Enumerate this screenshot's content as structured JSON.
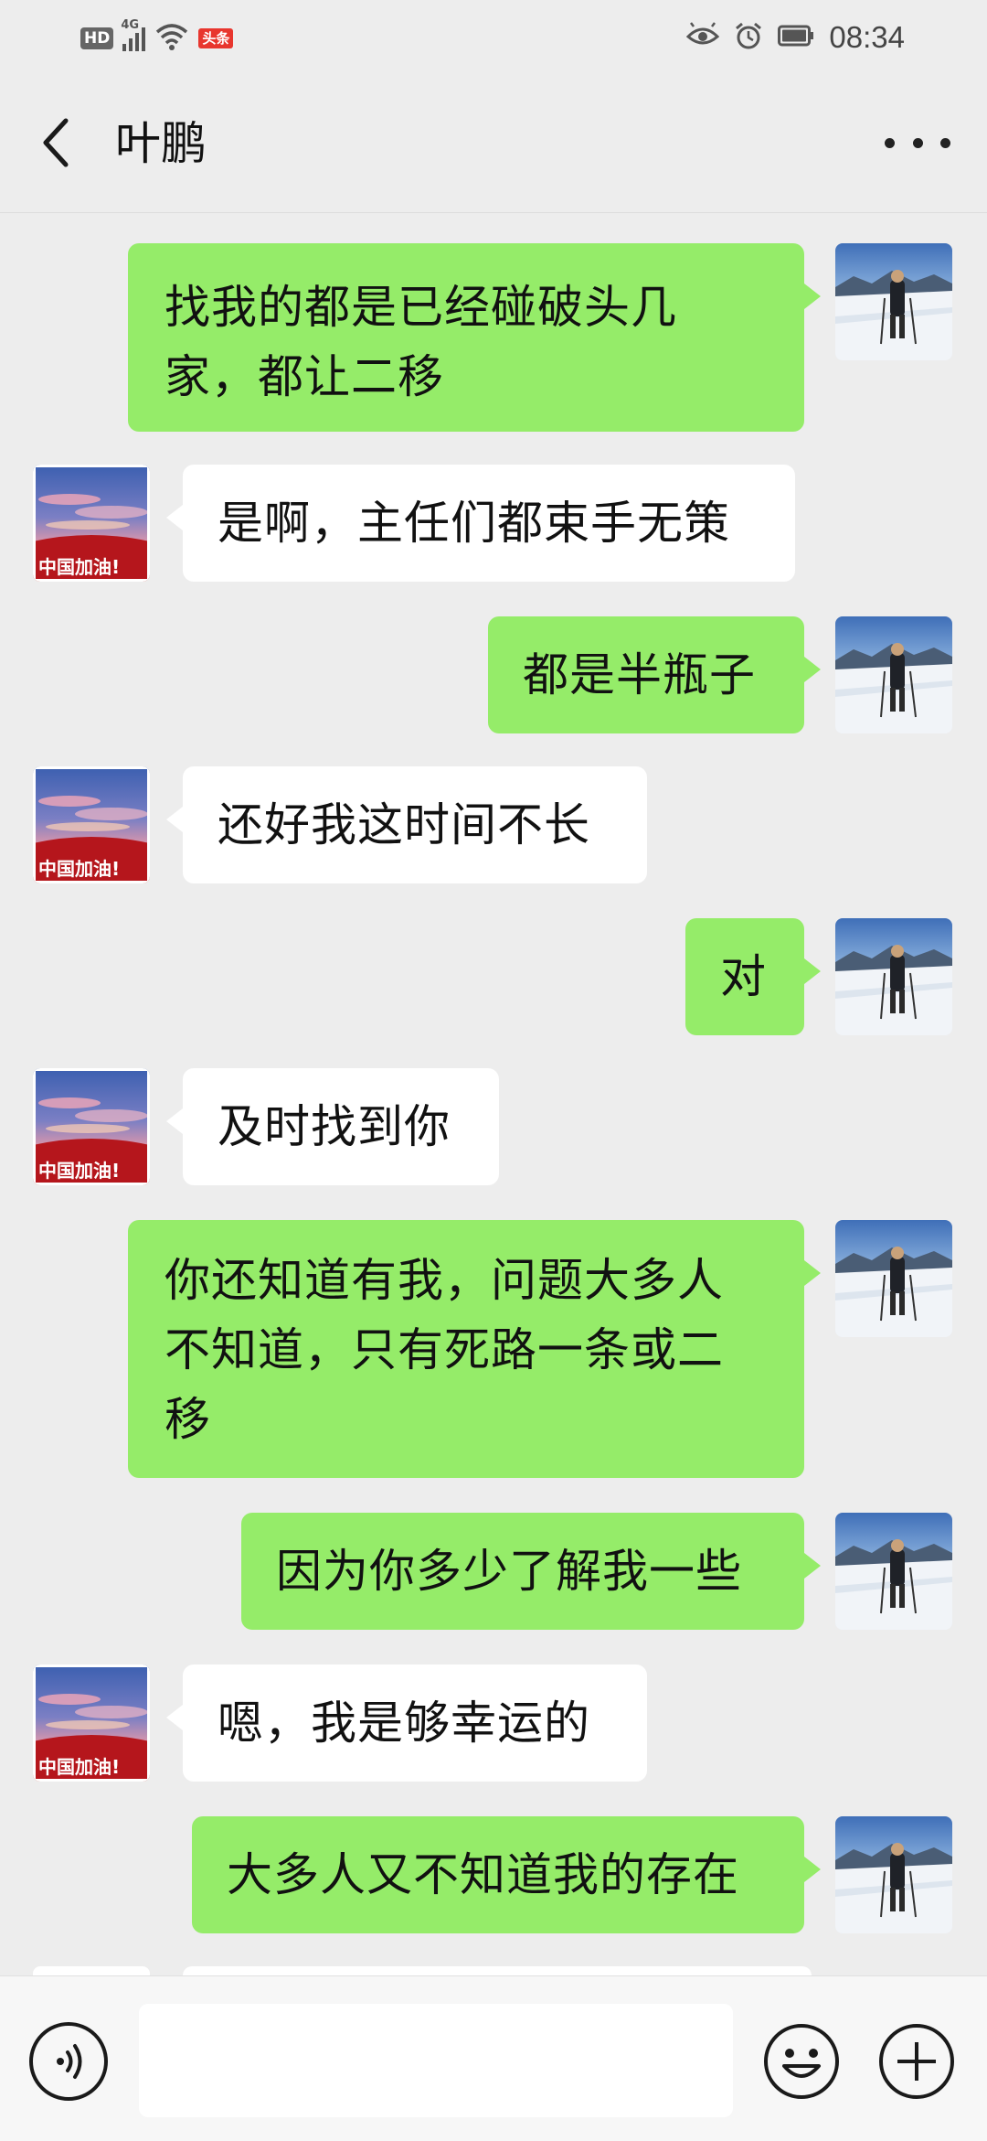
{
  "status_bar": {
    "hd": "HD",
    "network": "4G",
    "toutiao_badge": "头条",
    "time": "08:34"
  },
  "header": {
    "title": "叶鹏"
  },
  "avatars": {
    "other_caption": "中国加油!"
  },
  "messages": [
    {
      "from": "me",
      "text": "找我的都是已经碰破头几家，都让二移"
    },
    {
      "from": "other",
      "text": "是啊，主任们都束手无策"
    },
    {
      "from": "me",
      "text": "都是半瓶子"
    },
    {
      "from": "other",
      "text": "还好我这时间不长"
    },
    {
      "from": "me",
      "text": "对"
    },
    {
      "from": "other",
      "text": "及时找到你"
    },
    {
      "from": "me",
      "text": "你还知道有我，问题大多人不知道，只有死路一条或二移"
    },
    {
      "from": "me",
      "text": "因为你多少了解我一些"
    },
    {
      "from": "other",
      "text": "嗯，我是够幸运的"
    },
    {
      "from": "me",
      "text": "大多人又不知道我的存在"
    }
  ],
  "input_bar": {
    "placeholder": "",
    "value": ""
  },
  "colors": {
    "background": "#ededed",
    "my_bubble": "#95ec69",
    "their_bubble": "#ffffff",
    "toutiao_red": "#e8362e"
  }
}
